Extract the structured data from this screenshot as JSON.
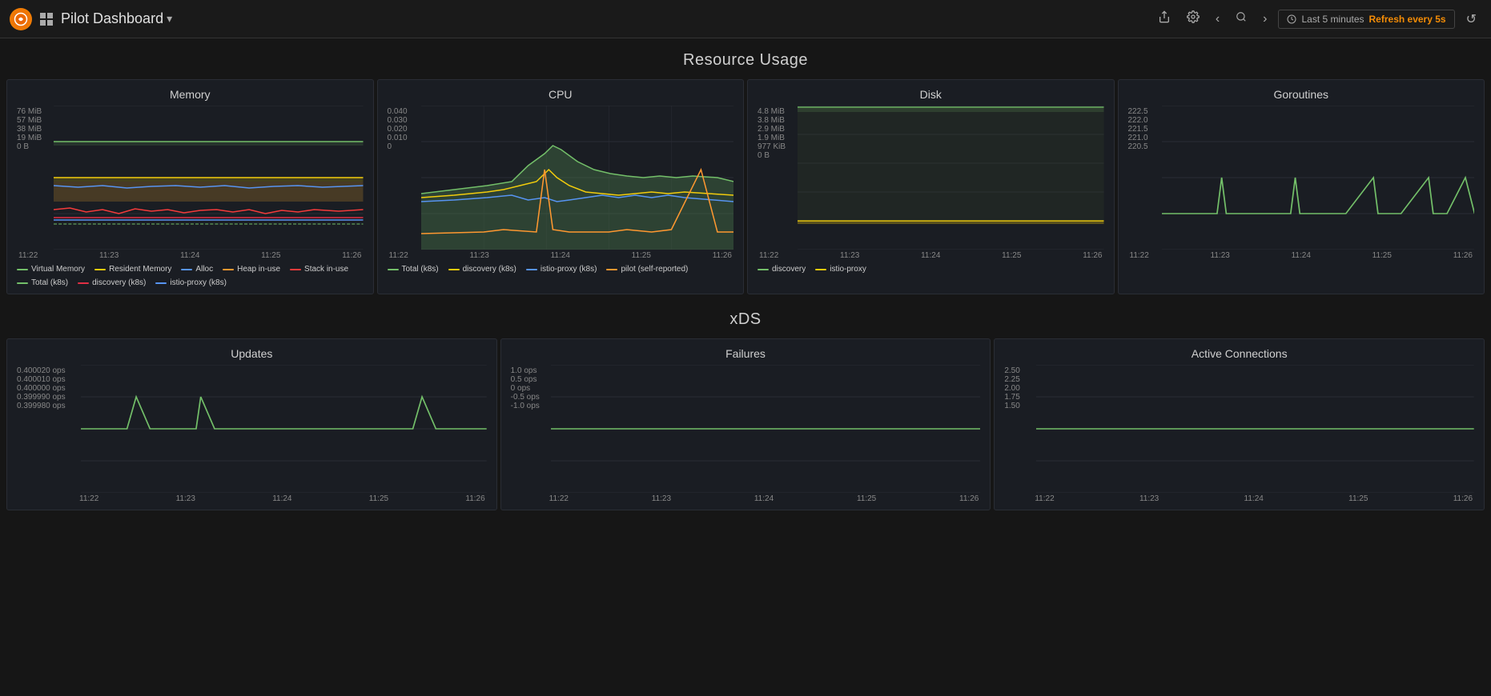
{
  "topbar": {
    "title": "Pilot Dashboard",
    "dropdown_arrow": "▾",
    "time_label": "Last 5 minutes",
    "refresh_label": "Refresh every 5s",
    "icons": {
      "share": "⬆",
      "gear": "⚙",
      "back": "‹",
      "search": "🔍",
      "forward": "›",
      "refresh": "↺"
    }
  },
  "resource_usage": {
    "header": "Resource Usage",
    "memory": {
      "title": "Memory",
      "y_labels": [
        "76 MiB",
        "57 MiB",
        "38 MiB",
        "19 MiB",
        "0 B"
      ],
      "x_labels": [
        "11:22",
        "11:23",
        "11:24",
        "11:25",
        "11:26"
      ],
      "legend": [
        {
          "color": "#73bf69",
          "label": "Virtual Memory"
        },
        {
          "color": "#f2cc0c",
          "label": "Resident Memory"
        },
        {
          "color": "#5794f2",
          "label": "Alloc"
        },
        {
          "color": "#ff9830",
          "label": "Heap in-use"
        },
        {
          "color": "#f43b3b",
          "label": "Stack in-use"
        },
        {
          "color": "#73bf69",
          "label": "Total (k8s)"
        },
        {
          "color": "#e02f44",
          "label": "discovery (k8s)"
        },
        {
          "color": "#5794f2",
          "label": "istio-proxy (k8s)"
        }
      ]
    },
    "cpu": {
      "title": "CPU",
      "y_labels": [
        "0.040",
        "0.030",
        "0.020",
        "0.010",
        "0"
      ],
      "x_labels": [
        "11:22",
        "11:23",
        "11:24",
        "11:25",
        "11:26"
      ],
      "legend": [
        {
          "color": "#73bf69",
          "label": "Total (k8s)"
        },
        {
          "color": "#f2cc0c",
          "label": "discovery (k8s)"
        },
        {
          "color": "#5794f2",
          "label": "istio-proxy (k8s)"
        },
        {
          "color": "#ff9830",
          "label": "pilot (self-reported)"
        }
      ]
    },
    "disk": {
      "title": "Disk",
      "y_labels": [
        "4.8 MiB",
        "3.8 MiB",
        "2.9 MiB",
        "1.9 MiB",
        "977 KiB",
        "0 B"
      ],
      "x_labels": [
        "11:22",
        "11:23",
        "11:24",
        "11:25",
        "11:26"
      ],
      "legend": [
        {
          "color": "#73bf69",
          "label": "discovery"
        },
        {
          "color": "#f2cc0c",
          "label": "istio-proxy"
        }
      ]
    },
    "goroutines": {
      "title": "Goroutines",
      "y_labels": [
        "222.5",
        "222.0",
        "221.5",
        "221.0",
        "220.5"
      ],
      "x_labels": [
        "11:22",
        "11:23",
        "11:24",
        "11:25",
        "11:26"
      ],
      "legend": []
    }
  },
  "xds": {
    "header": "xDS",
    "updates": {
      "title": "Updates",
      "y_labels": [
        "0.400020 ops",
        "0.400010 ops",
        "0.400000 ops",
        "0.399990 ops",
        "0.399980 ops"
      ],
      "x_labels": [
        "11:22",
        "11:23",
        "11:24",
        "11:25",
        "11:26"
      ]
    },
    "failures": {
      "title": "Failures",
      "y_labels": [
        "1.0 ops",
        "0.5 ops",
        "0 ops",
        "-0.5 ops",
        "-1.0 ops"
      ],
      "x_labels": [
        "11:22",
        "11:23",
        "11:24",
        "11:25",
        "11:26"
      ]
    },
    "active_connections": {
      "title": "Active Connections",
      "y_labels": [
        "2.50",
        "2.25",
        "2.00",
        "1.75",
        "1.50"
      ],
      "x_labels": [
        "11:22",
        "11:23",
        "11:24",
        "11:25",
        "11:26"
      ]
    }
  }
}
